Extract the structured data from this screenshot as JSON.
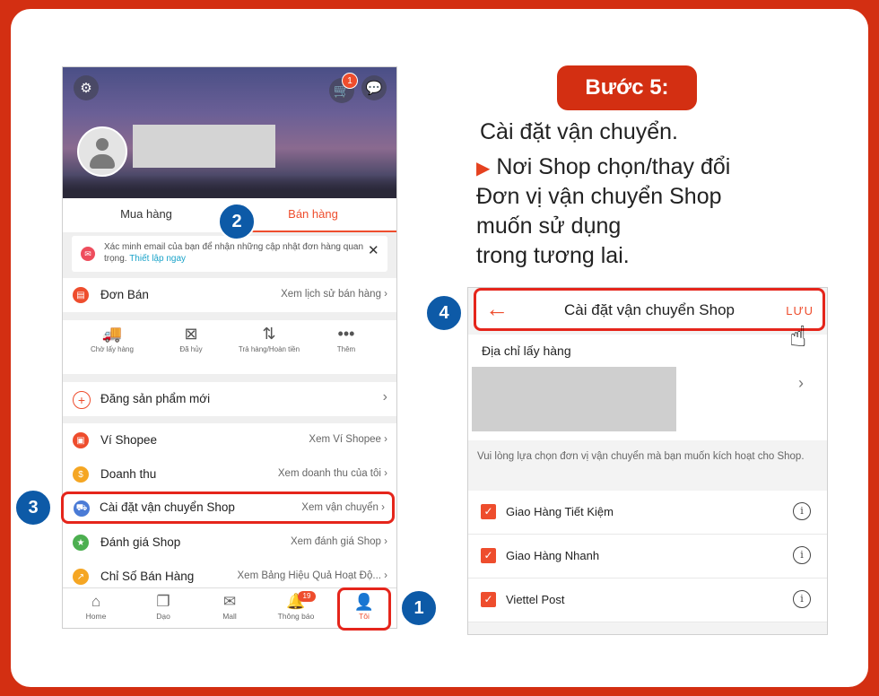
{
  "step": {
    "title": "Bước 5:",
    "lines": [
      "Cài đặt vận chuyển.",
      "Nơi Shop chọn/thay đổi",
      "Đơn vị vận chuyển Shop",
      "muốn sử dụng",
      "trong tương lai."
    ]
  },
  "profile": {
    "cart_count": "1",
    "tabs": [
      "Mua hàng",
      "Bán hàng"
    ],
    "active_tab": "Bán hàng"
  },
  "notice": {
    "text": "Xác minh email của bạn để nhận những cập nhật đơn hàng quan trọng.",
    "link": "Thiết lập ngay"
  },
  "orders": {
    "label": "Đơn Bán",
    "right": "Xem lịch sử bán hàng",
    "statuses": [
      "Chờ lấy hàng",
      "Đã hủy",
      "Trả hàng/Hoàn tiền",
      "Thêm"
    ]
  },
  "new_product": "Đăng sản phẩm mới",
  "menu": [
    {
      "label": "Ví Shopee",
      "right": "Xem Ví Shopee",
      "color": "#ee4d2d"
    },
    {
      "label": "Doanh thu",
      "right": "Xem doanh thu của tôi",
      "color": "#f5a623"
    },
    {
      "label": "Cài đặt vận chuyển Shop",
      "right": "Xem vận chuyển",
      "color": "#4a7bd6"
    },
    {
      "label": "Đánh giá Shop",
      "right": "Xem đánh giá Shop",
      "color": "#4caf50"
    },
    {
      "label": "Chỉ Số Bán Hàng",
      "right": "Xem Bảng Hiệu Quả Hoạt Độ...",
      "color": "#f5a623"
    }
  ],
  "bottom_nav": [
    "Home",
    "Dạo",
    "Mall",
    "Thông báo",
    "Tôi"
  ],
  "notif_count": "19",
  "markers": [
    "1",
    "2",
    "3",
    "4"
  ],
  "shipping": {
    "title": "Cài đặt vận chuyển Shop",
    "save": "LƯU",
    "address_label": "Địa chỉ lấy hàng",
    "hint": "Vui lòng lựa chọn đơn vị vận chuyển mà bạn muốn kích hoạt cho Shop.",
    "carriers": [
      "Giao Hàng Tiết Kiệm",
      "Giao Hàng Nhanh",
      "Viettel Post"
    ]
  },
  "colors": {
    "brand": "#ee4d2d",
    "frame": "#d32f12",
    "marker": "#0d5aa7",
    "highlight": "#e5251b"
  }
}
